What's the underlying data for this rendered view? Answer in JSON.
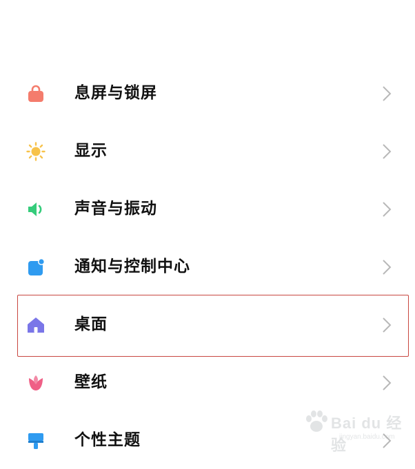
{
  "settings": {
    "items": [
      {
        "label": "息屏与锁屏",
        "icon": "lock-icon",
        "color": "#f47c6c"
      },
      {
        "label": "显示",
        "icon": "sun-icon",
        "color": "#f7c24a"
      },
      {
        "label": "声音与振动",
        "icon": "speaker-icon",
        "color": "#35cc7b"
      },
      {
        "label": "通知与控制中心",
        "icon": "notification-icon",
        "color": "#2f9bf0"
      },
      {
        "label": "桌面",
        "icon": "home-icon",
        "color": "#7a76e8",
        "highlighted": true
      },
      {
        "label": "壁纸",
        "icon": "tulip-icon",
        "color": "#ef5f86"
      },
      {
        "label": "个性主题",
        "icon": "paintbrush-icon",
        "color": "#2f9bf0"
      }
    ]
  },
  "highlight_color": "#c8463f",
  "watermark": {
    "text": "Bai du 经验",
    "sub": "jingyan.baidu.com"
  }
}
